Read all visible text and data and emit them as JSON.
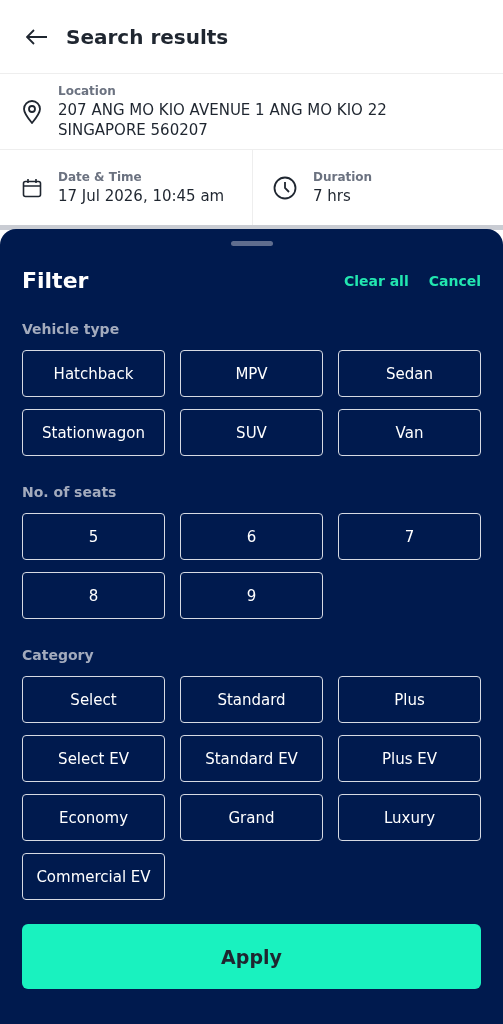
{
  "header": {
    "title": "Search results"
  },
  "location": {
    "label": "Location",
    "value": "207 ANG MO KIO AVENUE 1 ANG MO KIO 22 SINGAPORE 560207"
  },
  "date_time": {
    "label": "Date & Time",
    "value": "17 Jul 2026, 10:45 am"
  },
  "duration": {
    "label": "Duration",
    "value": "7 hrs"
  },
  "filter": {
    "title": "Filter",
    "clear_all": "Clear all",
    "cancel": "Cancel",
    "sections": [
      {
        "title": "Vehicle type",
        "options": [
          {
            "label": "Hatchback",
            "selected": false
          },
          {
            "label": "MPV",
            "selected": false
          },
          {
            "label": "Sedan",
            "selected": false
          },
          {
            "label": "Stationwagon",
            "selected": false
          },
          {
            "label": "SUV",
            "selected": false
          },
          {
            "label": "Van",
            "selected": false
          }
        ]
      },
      {
        "title": "No. of seats",
        "options": [
          {
            "label": "5",
            "selected": false
          },
          {
            "label": "6",
            "selected": false
          },
          {
            "label": "7",
            "selected": false
          },
          {
            "label": "8",
            "selected": false
          },
          {
            "label": "9",
            "selected": false
          }
        ]
      },
      {
        "title": "Category",
        "options": [
          {
            "label": "Select",
            "selected": false
          },
          {
            "label": "Standard",
            "selected": false
          },
          {
            "label": "Plus",
            "selected": false
          },
          {
            "label": "Select EV",
            "selected": false
          },
          {
            "label": "Standard EV",
            "selected": false
          },
          {
            "label": "Plus EV",
            "selected": false
          },
          {
            "label": "Economy",
            "selected": false
          },
          {
            "label": "Grand",
            "selected": false
          },
          {
            "label": "Luxury",
            "selected": false
          },
          {
            "label": "Commercial EV",
            "selected": false
          }
        ]
      }
    ],
    "apply": "Apply"
  }
}
